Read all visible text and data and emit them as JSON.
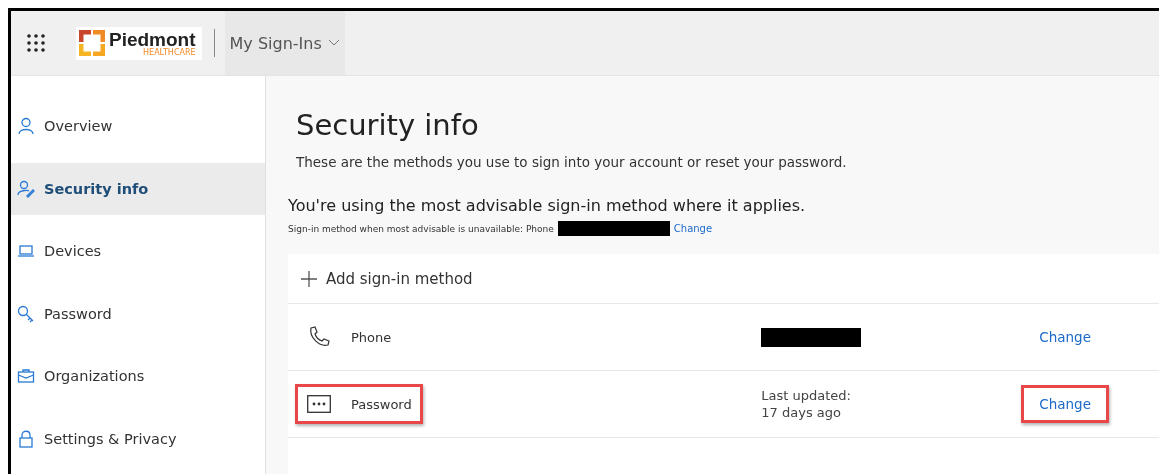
{
  "header": {
    "logo": {
      "name": "Piedmont",
      "tagline": "HEALTHCARE"
    },
    "app_title": "My Sign-Ins"
  },
  "sidebar": {
    "items": [
      {
        "label": "Overview",
        "selected": false
      },
      {
        "label": "Security info",
        "selected": true
      },
      {
        "label": "Devices",
        "selected": false
      },
      {
        "label": "Password",
        "selected": false
      },
      {
        "label": "Organizations",
        "selected": false
      },
      {
        "label": "Settings & Privacy",
        "selected": false
      }
    ]
  },
  "main": {
    "title": "Security info",
    "description": "These are the methods you use to sign into your account or reset your password.",
    "advisory": "You're using the most advisable sign-in method where it applies.",
    "fallback": {
      "text": "Sign-in method when most advisable is unavailable: Phone",
      "redacted": true,
      "link": "Change"
    },
    "add_method": "Add sign-in method",
    "methods": [
      {
        "kind": "phone",
        "name": "Phone",
        "detail_redacted": true,
        "action": "Change",
        "highlighted": false
      },
      {
        "kind": "password",
        "name": "Password",
        "detail_lines": [
          "Last updated:",
          "17 days ago"
        ],
        "detail_redacted": false,
        "action": "Change",
        "highlighted": true
      }
    ]
  }
}
